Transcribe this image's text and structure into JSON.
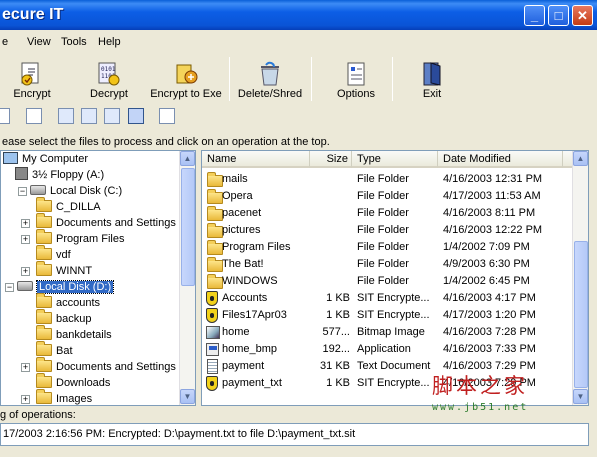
{
  "window": {
    "title": "ecure IT"
  },
  "menu": [
    "e",
    "View",
    "Tools",
    "Help"
  ],
  "toolbar": [
    {
      "label": "Encrypt",
      "icon": "encrypt-icon"
    },
    {
      "label": "Decrypt",
      "icon": "decrypt-icon"
    },
    {
      "label": "Encrypt to Exe",
      "icon": "encrypt-exe-icon"
    },
    {
      "label": "Delete/Shred",
      "icon": "shred-icon"
    },
    {
      "label": "Options",
      "icon": "options-icon"
    },
    {
      "label": "Exit",
      "icon": "exit-icon"
    }
  ],
  "instruction": "ease select the files to process and click on an operation at the top.",
  "tree": [
    {
      "label": "My Computer"
    },
    {
      "label": "3½ Floppy (A:)"
    },
    {
      "label": "Local Disk (C:)"
    },
    {
      "label": "C_DILLA"
    },
    {
      "label": "Documents and Settings"
    },
    {
      "label": "Program Files"
    },
    {
      "label": "vdf"
    },
    {
      "label": "WINNT"
    },
    {
      "label": "Local Disk (D:)"
    },
    {
      "label": "accounts"
    },
    {
      "label": "backup"
    },
    {
      "label": "bankdetails"
    },
    {
      "label": "Bat"
    },
    {
      "label": "Documents and Settings"
    },
    {
      "label": "Downloads"
    },
    {
      "label": "Images"
    }
  ],
  "list": {
    "columns": [
      "Name",
      "Size",
      "Type",
      "Date Modified"
    ],
    "rows": [
      {
        "name": "mails",
        "size": "",
        "type": "File Folder",
        "date": "4/16/2003 12:31 PM",
        "icon": "folder"
      },
      {
        "name": "Opera",
        "size": "",
        "type": "File Folder",
        "date": "4/17/2003 11:53 AM",
        "icon": "folder"
      },
      {
        "name": "pacenet",
        "size": "",
        "type": "File Folder",
        "date": "4/16/2003 8:11 PM",
        "icon": "folder"
      },
      {
        "name": "pictures",
        "size": "",
        "type": "File Folder",
        "date": "4/16/2003 12:22 PM",
        "icon": "folder"
      },
      {
        "name": "Program Files",
        "size": "",
        "type": "File Folder",
        "date": "1/4/2002 7:09 PM",
        "icon": "folder"
      },
      {
        "name": "The Bat!",
        "size": "",
        "type": "File Folder",
        "date": "4/9/2003 6:30 PM",
        "icon": "folder"
      },
      {
        "name": "WINDOWS",
        "size": "",
        "type": "File Folder",
        "date": "1/4/2002 6:45 PM",
        "icon": "folder"
      },
      {
        "name": "Accounts",
        "size": "1 KB",
        "type": "SIT Encrypte...",
        "date": "4/16/2003 4:17 PM",
        "icon": "shield"
      },
      {
        "name": "Files17Apr03",
        "size": "1 KB",
        "type": "SIT Encrypte...",
        "date": "4/17/2003 1:20 PM",
        "icon": "shield"
      },
      {
        "name": "home",
        "size": "577...",
        "type": "Bitmap Image",
        "date": "4/16/2003 7:28 PM",
        "icon": "bmp"
      },
      {
        "name": "home_bmp",
        "size": "192...",
        "type": "Application",
        "date": "4/16/2003 7:33 PM",
        "icon": "app"
      },
      {
        "name": "payment",
        "size": "31 KB",
        "type": "Text Document",
        "date": "4/16/2003 7:29 PM",
        "icon": "txt"
      },
      {
        "name": "payment_txt",
        "size": "1 KB",
        "type": "SIT Encrypte...",
        "date": "4/16/2003 7:29 PM",
        "icon": "shield"
      }
    ]
  },
  "operations": {
    "label": "g of operations:",
    "entry": "17/2003 2:16:56 PM: Encrypted: D:\\payment.txt to file D:\\payment_txt.sit"
  },
  "watermark": {
    "main": "脚本之家",
    "url": "www.jb51.net"
  },
  "colors": {
    "titlebar": "#0a54d6",
    "selection": "#316ac5",
    "window_bg": "#ece9d8"
  }
}
